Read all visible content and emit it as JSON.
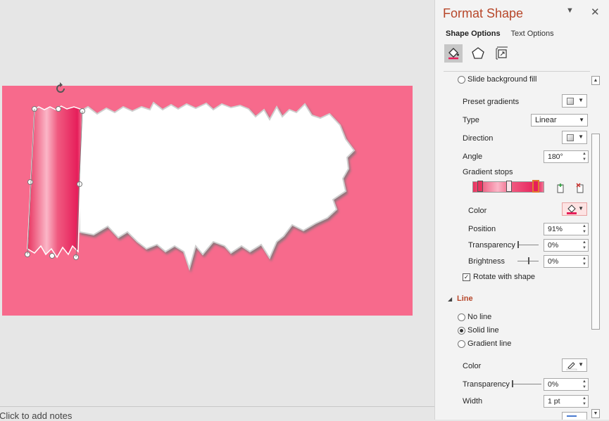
{
  "notes": {
    "placeholder": "Click to add notes"
  },
  "pane": {
    "title": "Format Shape",
    "tabs": {
      "shape_options": "Shape Options",
      "text_options": "Text Options"
    },
    "fill": {
      "slide_background_fill": "Slide background fill",
      "preset_gradients": "Preset gradients",
      "type_label": "Type",
      "type_value": "Linear",
      "direction_label": "Direction",
      "angle_label": "Angle",
      "angle_value": "180°",
      "gradient_stops_label": "Gradient stops",
      "color_label": "Color",
      "position_label": "Position",
      "position_value": "91%",
      "transparency_label": "Transparency",
      "transparency_value": "0%",
      "brightness_label": "Brightness",
      "brightness_value": "0%",
      "rotate_with_shape": "Rotate with shape"
    },
    "line": {
      "section_title": "Line",
      "no_line": "No line",
      "solid_line": "Solid line",
      "gradient_line": "Gradient line",
      "color_label": "Color",
      "transparency_label": "Transparency",
      "transparency_value": "0%",
      "width_label": "Width",
      "width_value": "1 pt"
    }
  },
  "colors": {
    "accent": "#b7472a",
    "slide_bg": "#f76a8c",
    "gradient_pink": "#ec3563",
    "selected_color": "#e61e5a"
  }
}
